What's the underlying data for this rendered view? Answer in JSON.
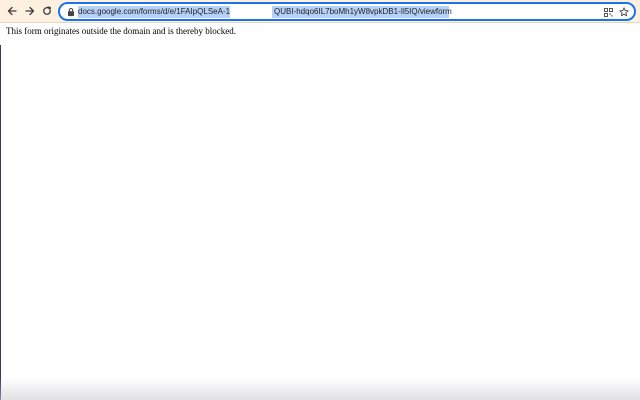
{
  "browser": {
    "toolbar_color": "#fdf0df",
    "back_icon": "back-arrow-icon",
    "forward_icon": "forward-arrow-icon",
    "reload_icon": "reload-icon",
    "lock_icon": "lock-icon",
    "address_bar": {
      "url_part1": "docs.google.com/forms/d/e/1FAIpQLSeA-1",
      "url_part2": "QUBI-hdqo6IL7boMh1yW8vpkDB1-Il5IQ/viewform",
      "selection_color": "#b6d1f7"
    },
    "qr_icon": "qr-code-icon",
    "bookmark_icon": "star-icon"
  },
  "page": {
    "message": "This form originates outside the domain and is thereby blocked."
  }
}
